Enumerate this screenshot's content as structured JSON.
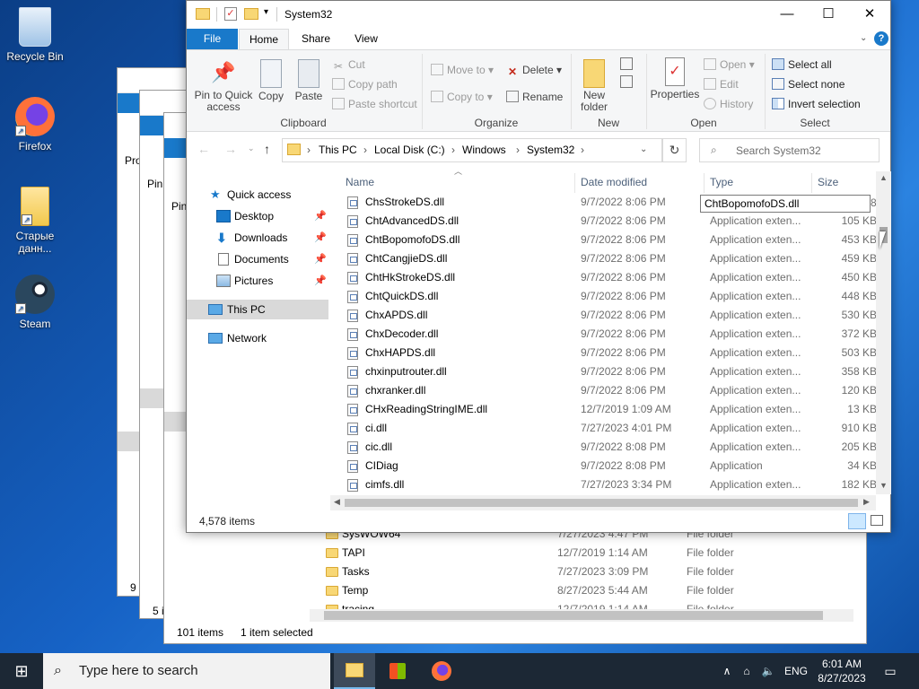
{
  "desktop": {
    "icons": [
      {
        "label": "Recycle Bin",
        "icon": "recycle-bin-icon"
      },
      {
        "label": "Firefox",
        "icon": "firefox-icon"
      },
      {
        "label": "Старые данн...",
        "icon": "folder-icon"
      },
      {
        "label": "Steam",
        "icon": "steam-icon"
      }
    ]
  },
  "bg_windows": {
    "win1_items": "9 i",
    "win2_items": "5 i",
    "win3_count": "101 items",
    "win3_selected": "1 item selected",
    "win1_fragment": "Pro",
    "win2_fragment": "Pin",
    "win3_fragment": "Pin",
    "win3_rows": [
      {
        "name": "SysWOW64",
        "date": "7/27/2023 4:47 PM",
        "type": "File folder"
      },
      {
        "name": "TAPI",
        "date": "12/7/2019 1:14 AM",
        "type": "File folder"
      },
      {
        "name": "Tasks",
        "date": "7/27/2023 3:09 PM",
        "type": "File folder"
      },
      {
        "name": "Temp",
        "date": "8/27/2023 5:44 AM",
        "type": "File folder"
      },
      {
        "name": "tracing",
        "date": "12/7/2019 1:14 AM",
        "type": "File folder"
      }
    ]
  },
  "window": {
    "title": "System32",
    "controls": {
      "minimize": "—",
      "maximize": "☐",
      "close": "✕"
    },
    "tabs": {
      "file": "File",
      "home": "Home",
      "share": "Share",
      "view": "View"
    },
    "help": "?",
    "ribbon": {
      "pin": "Pin to Quick access",
      "copy": "Copy",
      "paste": "Paste",
      "cut": "Cut",
      "copy_path": "Copy path",
      "paste_shortcut": "Paste shortcut",
      "clipboard": "Clipboard",
      "move_to": "Move to",
      "copy_to": "Copy to",
      "delete": "Delete",
      "rename": "Rename",
      "organize": "Organize",
      "new_folder": "New folder",
      "new": "New",
      "properties": "Properties",
      "open": "Open",
      "edit": "Edit",
      "history": "History",
      "open_group": "Open",
      "select_all": "Select all",
      "select_none": "Select none",
      "invert_selection": "Invert selection",
      "select_group": "Select"
    },
    "address": {
      "crumbs": [
        "This PC",
        "Local Disk (C:)",
        "Windows",
        "System32"
      ],
      "search_placeholder": "Search System32"
    },
    "nav": {
      "quick_access": "Quick access",
      "desktop": "Desktop",
      "downloads": "Downloads",
      "documents": "Documents",
      "pictures": "Pictures",
      "this_pc": "This PC",
      "network": "Network"
    },
    "columns": {
      "name": "Name",
      "date": "Date modified",
      "type": "Type",
      "size": "Size"
    },
    "rename_value": "ChtBopomofoDS.dll",
    "partial_size": "8",
    "files": [
      {
        "name": "ChsStrokeDS.dll",
        "date": "9/7/2022 8:06 PM",
        "type": "",
        "size": ""
      },
      {
        "name": "ChtAdvancedDS.dll",
        "date": "9/7/2022 8:06 PM",
        "type": "Application exten...",
        "size": "105 KB"
      },
      {
        "name": "ChtBopomofoDS.dll",
        "date": "9/7/2022 8:06 PM",
        "type": "Application exten...",
        "size": "453 KB"
      },
      {
        "name": "ChtCangjieDS.dll",
        "date": "9/7/2022 8:06 PM",
        "type": "Application exten...",
        "size": "459 KB"
      },
      {
        "name": "ChtHkStrokeDS.dll",
        "date": "9/7/2022 8:06 PM",
        "type": "Application exten...",
        "size": "450 KB"
      },
      {
        "name": "ChtQuickDS.dll",
        "date": "9/7/2022 8:06 PM",
        "type": "Application exten...",
        "size": "448 KB"
      },
      {
        "name": "ChxAPDS.dll",
        "date": "9/7/2022 8:06 PM",
        "type": "Application exten...",
        "size": "530 KB"
      },
      {
        "name": "ChxDecoder.dll",
        "date": "9/7/2022 8:06 PM",
        "type": "Application exten...",
        "size": "372 KB"
      },
      {
        "name": "ChxHAPDS.dll",
        "date": "9/7/2022 8:06 PM",
        "type": "Application exten...",
        "size": "503 KB"
      },
      {
        "name": "chxinputrouter.dll",
        "date": "9/7/2022 8:06 PM",
        "type": "Application exten...",
        "size": "358 KB"
      },
      {
        "name": "chxranker.dll",
        "date": "9/7/2022 8:06 PM",
        "type": "Application exten...",
        "size": "120 KB"
      },
      {
        "name": "CHxReadingStringIME.dll",
        "date": "12/7/2019 1:09 AM",
        "type": "Application exten...",
        "size": "13 KB"
      },
      {
        "name": "ci.dll",
        "date": "7/27/2023 4:01 PM",
        "type": "Application exten...",
        "size": "910 KB"
      },
      {
        "name": "cic.dll",
        "date": "9/7/2022 8:08 PM",
        "type": "Application exten...",
        "size": "205 KB"
      },
      {
        "name": "CIDiag",
        "date": "9/7/2022 8:08 PM",
        "type": "Application",
        "size": "34 KB"
      },
      {
        "name": "cimfs.dll",
        "date": "7/27/2023 3:34 PM",
        "type": "Application exten...",
        "size": "182 KB"
      }
    ],
    "status": {
      "count": "4,578 items"
    }
  },
  "taskbar": {
    "search_placeholder": "Type here to search",
    "lang": "ENG",
    "time": "6:01 AM",
    "date": "8/27/2023"
  },
  "colors": {
    "accent": "#1979ca",
    "selection": "#cce8ff",
    "taskbar": "#1c2835"
  }
}
